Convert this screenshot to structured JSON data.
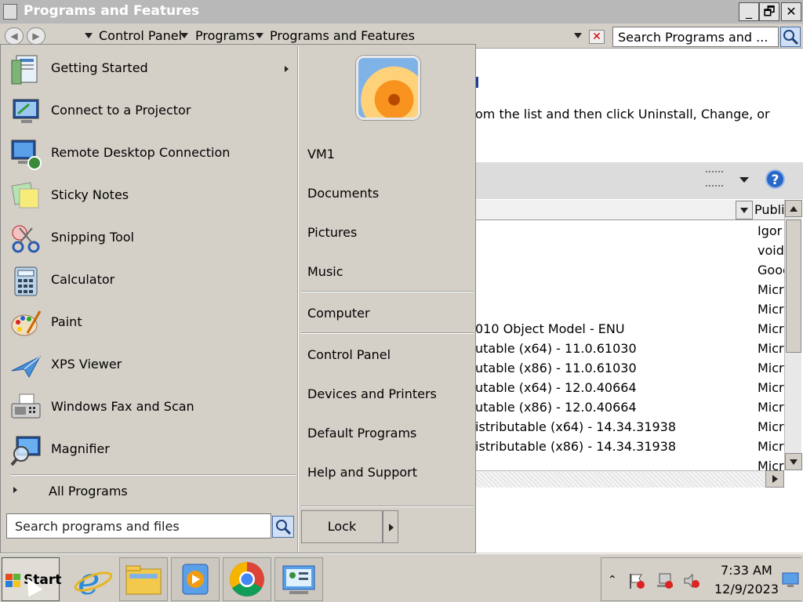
{
  "window": {
    "title": "Programs and Features",
    "minimize": "_",
    "maximize": "🗗",
    "close": "✕",
    "breadcrumb": [
      "Control Panel",
      "Programs",
      "Programs and Features"
    ],
    "search_placeholder": "Search Programs and ...",
    "content_text": "om the list and then click Uninstall, Change, or",
    "help": "?",
    "column_publisher": "Publi",
    "rows": [
      {
        "name": "",
        "publisher": "Igor"
      },
      {
        "name": "",
        "publisher": "voidt"
      },
      {
        "name": "",
        "publisher": "Goog"
      },
      {
        "name": "",
        "publisher": "Micro"
      },
      {
        "name": "",
        "publisher": "Micro"
      },
      {
        "name": "010 Object Model - ENU",
        "publisher": "Micro"
      },
      {
        "name": "utable (x64) - 11.0.61030",
        "publisher": "Micro"
      },
      {
        "name": "utable (x86) - 11.0.61030",
        "publisher": "Micro"
      },
      {
        "name": "utable (x64) - 12.0.40664",
        "publisher": "Micro"
      },
      {
        "name": "utable (x86) - 12.0.40664",
        "publisher": "Micro"
      },
      {
        "name": "istributable (x64) - 14.34.31938",
        "publisher": "Micro"
      },
      {
        "name": "istributable (x86) - 14.34.31938",
        "publisher": "Micro"
      },
      {
        "name": "",
        "publisher": "Micro"
      }
    ]
  },
  "start_menu": {
    "programs": [
      {
        "label": "Getting Started",
        "icon": "getting-started-icon",
        "submenu": true
      },
      {
        "label": "Connect to a Projector",
        "icon": "projector-icon",
        "submenu": false
      },
      {
        "label": "Remote Desktop Connection",
        "icon": "remote-desktop-icon",
        "submenu": false
      },
      {
        "label": "Sticky Notes",
        "icon": "sticky-notes-icon",
        "submenu": false
      },
      {
        "label": "Snipping Tool",
        "icon": "snipping-tool-icon",
        "submenu": false
      },
      {
        "label": "Calculator",
        "icon": "calculator-icon",
        "submenu": false
      },
      {
        "label": "Paint",
        "icon": "paint-icon",
        "submenu": false
      },
      {
        "label": "XPS Viewer",
        "icon": "xps-viewer-icon",
        "submenu": false
      },
      {
        "label": "Windows Fax and Scan",
        "icon": "fax-scan-icon",
        "submenu": false
      },
      {
        "label": "Magnifier",
        "icon": "magnifier-icon",
        "submenu": false
      }
    ],
    "all_programs": "All Programs",
    "search_placeholder": "Search programs and files",
    "right_links": {
      "user": "VM1",
      "documents": "Documents",
      "pictures": "Pictures",
      "music": "Music",
      "computer": "Computer",
      "control_panel": "Control Panel",
      "devices": "Devices and Printers",
      "defaults": "Default Programs",
      "help": "Help and Support"
    },
    "lock": "Lock"
  },
  "taskbar": {
    "start": "Start",
    "pinned": [
      "internet-explorer-icon",
      "file-explorer-icon",
      "media-player-icon",
      "chrome-icon",
      "control-panel-icon"
    ],
    "time": "7:33 AM",
    "date": "12/9/2023"
  },
  "colors": {
    "menu_bg": "#d4d0c8",
    "title_bg": "#b8b8b8",
    "help_blue": "#2767c6"
  }
}
